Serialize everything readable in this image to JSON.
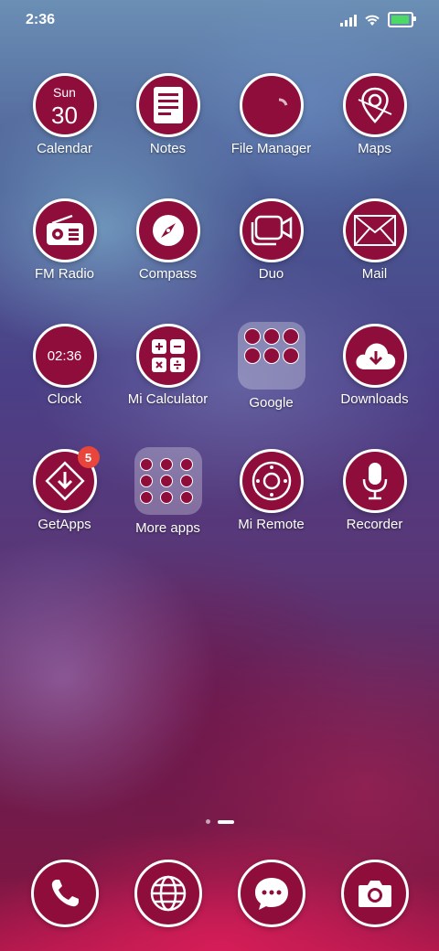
{
  "status_bar": {
    "time": "2:36",
    "battery_level": 0.95
  },
  "apps": [
    {
      "label": "Calendar"
    },
    {
      "label": "Notes"
    },
    {
      "label": "File Manager"
    },
    {
      "label": "Maps"
    },
    {
      "label": "FM Radio"
    },
    {
      "label": "Compass"
    },
    {
      "label": "Duo"
    },
    {
      "label": "Mail"
    },
    {
      "label": "Clock"
    },
    {
      "label": "Mi Calculator"
    },
    {
      "label": "Google"
    },
    {
      "label": "Downloads"
    },
    {
      "label": "GetApps"
    },
    {
      "label": "More apps"
    },
    {
      "label": "Mi Remote"
    },
    {
      "label": "Recorder"
    }
  ],
  "calendar": {
    "day": "Sun",
    "date": "30"
  },
  "clock": {
    "time": "02:36"
  },
  "getapps_badge": "5",
  "dock": [
    {
      "icon": "phone-icon"
    },
    {
      "icon": "globe-icon"
    },
    {
      "icon": "message-icon"
    },
    {
      "icon": "camera-icon"
    }
  ],
  "colors": {
    "icon_bg": "#8e0d3a",
    "badge": "#e8453c",
    "battery": "#4cd964"
  },
  "page_indicator": {
    "pages": 2,
    "current": 2
  }
}
